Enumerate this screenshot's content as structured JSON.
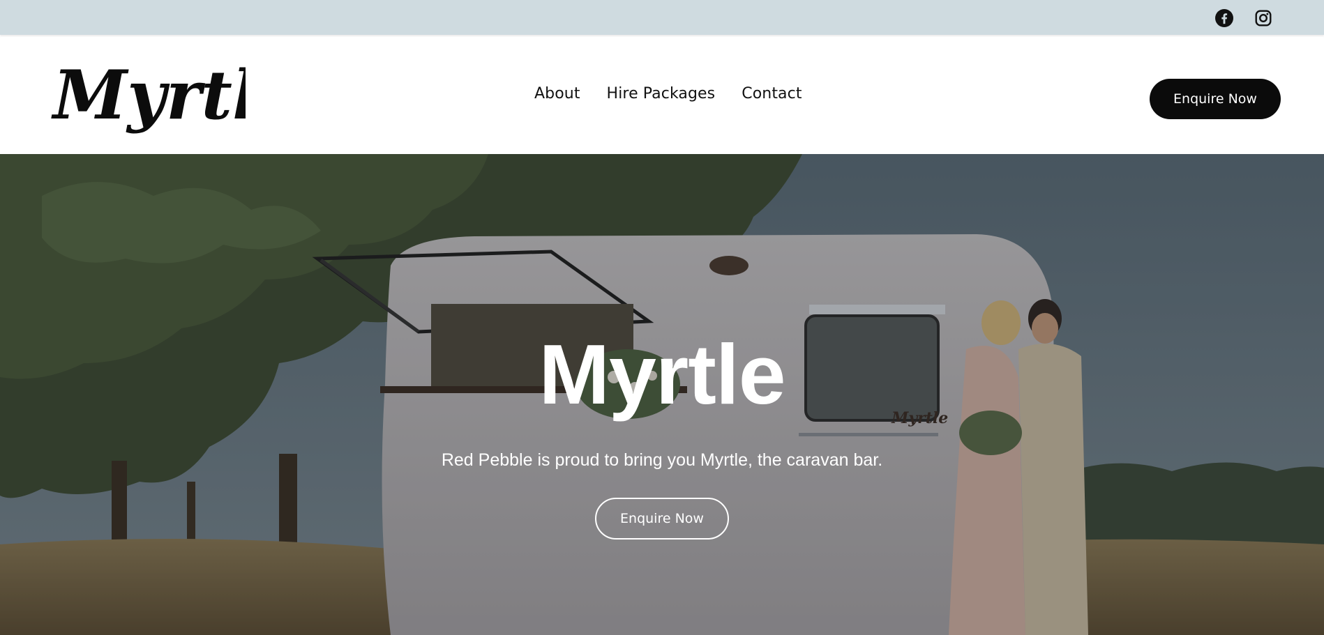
{
  "topbar": {
    "icons": [
      "facebook-icon",
      "instagram-icon"
    ],
    "background": "#cfdbe0"
  },
  "header": {
    "logo_text": "Myrtle",
    "nav": [
      "About",
      "Hire Packages",
      "Contact"
    ],
    "cta_label": "Enquire Now",
    "cta_color": "#0b0b0b"
  },
  "hero": {
    "title": "Myrtle",
    "subtitle": "Red Pebble is proud to bring you Myrtle, the caravan bar.",
    "cta_label": "Enquire Now",
    "caravan_logo_text": "Myrtle"
  }
}
